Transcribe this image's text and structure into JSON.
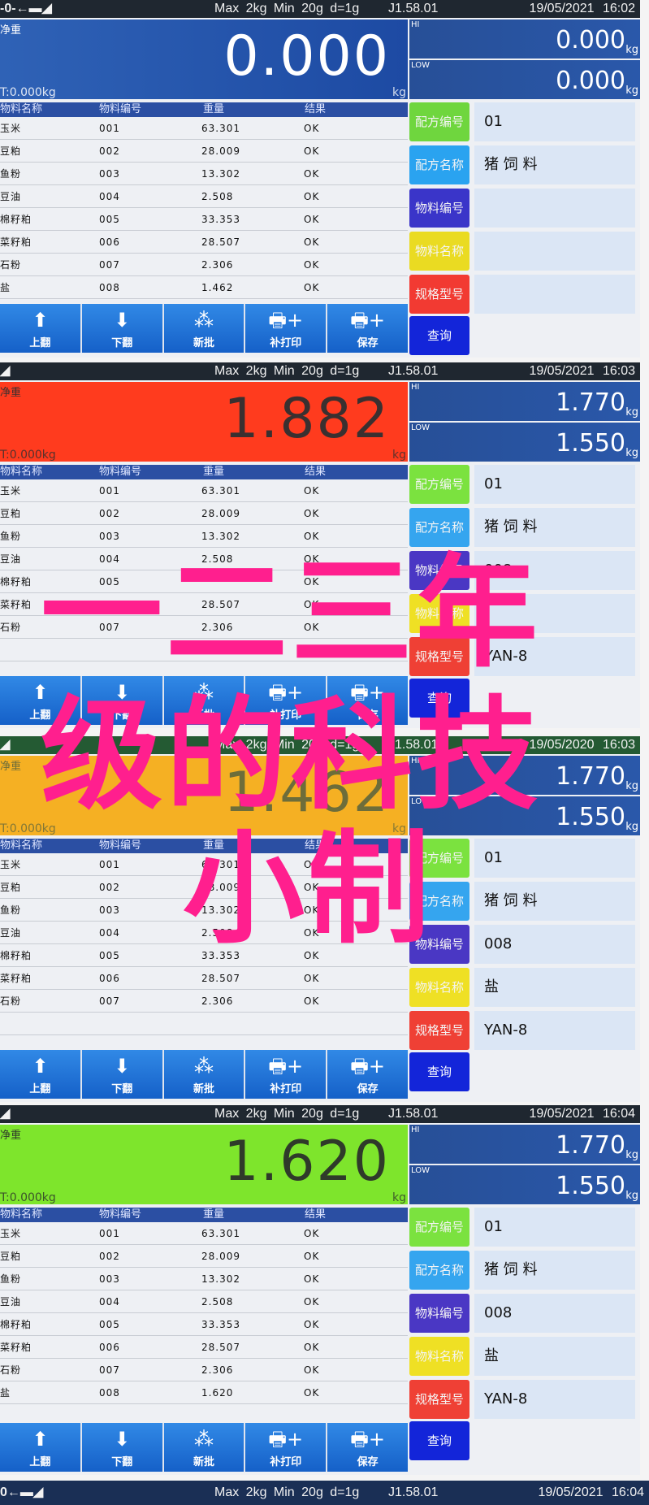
{
  "screens": [
    {
      "status": {
        "zero_icon": "-0-←▬◢",
        "spec": "Max 2kg  Min 20g  d=1g",
        "version": "J1.58.01",
        "datetime": "19/05/2021  16:02"
      },
      "net": {
        "label": "净重",
        "value": "0.000",
        "tare": "T:0.000kg",
        "unit": "kg",
        "state_color": "#2458ad"
      },
      "hi": {
        "tag": "HI",
        "value": "0.000",
        "unit": "kg"
      },
      "low": {
        "tag": "LOW",
        "value": "0.000",
        "unit": "kg"
      },
      "table": {
        "headers": [
          "物料名称",
          "物料编号",
          "重量",
          "结果"
        ],
        "rows": [
          [
            "玉米",
            "001",
            "63.301",
            "OK"
          ],
          [
            "豆粕",
            "002",
            "28.009",
            "OK"
          ],
          [
            "鱼粉",
            "003",
            "13.302",
            "OK"
          ],
          [
            "豆油",
            "004",
            "2.508",
            "OK"
          ],
          [
            "棉籽粕",
            "005",
            "33.353",
            "OK"
          ],
          [
            "菜籽粕",
            "006",
            "28.507",
            "OK"
          ],
          [
            "石粉",
            "007",
            "2.306",
            "OK"
          ],
          [
            "盐",
            "008",
            "1.462",
            "OK"
          ]
        ]
      },
      "side": [
        {
          "label": "配方编号",
          "value": "01",
          "color": "#6fd63e"
        },
        {
          "label": "配方名称",
          "value": "猪 饲 料",
          "color": "#2aa3f0"
        },
        {
          "label": "物料编号",
          "value": "",
          "color": "#3a35c9"
        },
        {
          "label": "物料名称",
          "value": "",
          "color": "#eadb22"
        },
        {
          "label": "规格型号",
          "value": "",
          "color": "#f23a32"
        }
      ]
    },
    {
      "status": {
        "zero_icon": "◢",
        "spec": "Max 2kg  Min 20g  d=1g",
        "version": "J1.58.01",
        "datetime": "19/05/2021  16:03"
      },
      "net": {
        "label": "净重",
        "value": "1.882",
        "tare": "T:0.000kg",
        "unit": "kg",
        "state_color": "#ff3b1e"
      },
      "hi": {
        "tag": "HI",
        "value": "1.770",
        "unit": "kg"
      },
      "low": {
        "tag": "LOW",
        "value": "1.550",
        "unit": "kg"
      },
      "table": {
        "headers": [
          "物料名称",
          "物料编号",
          "重量",
          "结果"
        ],
        "rows": [
          [
            "玉米",
            "001",
            "63.301",
            "OK"
          ],
          [
            "豆粕",
            "002",
            "28.009",
            "OK"
          ],
          [
            "鱼粉",
            "003",
            "13.302",
            "OK"
          ],
          [
            "豆油",
            "004",
            "2.508",
            "OK"
          ],
          [
            "棉籽粕",
            "005",
            "",
            "OK"
          ],
          [
            "菜籽粕",
            "006",
            "28.507",
            "OK"
          ],
          [
            "石粉",
            "007",
            "2.306",
            "OK"
          ],
          [
            "",
            "",
            "",
            ""
          ]
        ]
      },
      "side": [
        {
          "label": "配方编号",
          "value": "01",
          "color": "#7be23f"
        },
        {
          "label": "配方名称",
          "value": "猪 饲 料",
          "color": "#35a5ef"
        },
        {
          "label": "物料编号",
          "value": "008",
          "color": "#4a37c4"
        },
        {
          "label": "物料名称",
          "value": "",
          "color": "#efe024"
        },
        {
          "label": "规格型号",
          "value": "YAN-8",
          "color": "#ef4035"
        }
      ]
    },
    {
      "status": {
        "zero_icon": "◢",
        "spec": "Max 2kg  Min 20g  d=1g",
        "version": "J1.58.01",
        "datetime": "19/05/2020  16:03"
      },
      "net": {
        "label": "净重",
        "value": "1.462",
        "tare": "T:0.000kg",
        "unit": "kg",
        "state_color": "#f5b023"
      },
      "hi": {
        "tag": "HI",
        "value": "1.770",
        "unit": "kg"
      },
      "low": {
        "tag": "LOW",
        "value": "1.550",
        "unit": "kg"
      },
      "table": {
        "headers": [
          "物料名称",
          "物料编号",
          "重量",
          "结果"
        ],
        "rows": [
          [
            "玉米",
            "001",
            "63.301",
            "OK"
          ],
          [
            "豆粕",
            "002",
            "28.009",
            "OK"
          ],
          [
            "鱼粉",
            "003",
            "13.302",
            "OK"
          ],
          [
            "豆油",
            "004",
            "2.508",
            "OK"
          ],
          [
            "棉籽粕",
            "005",
            "33.353",
            "OK"
          ],
          [
            "菜籽粕",
            "006",
            "28.507",
            "OK"
          ],
          [
            "石粉",
            "007",
            "2.306",
            "OK"
          ],
          [
            "",
            "",
            "",
            ""
          ]
        ]
      },
      "side": [
        {
          "label": "配方编号",
          "value": "01",
          "color": "#7be23f"
        },
        {
          "label": "配方名称",
          "value": "猪 饲 料",
          "color": "#35a5ef"
        },
        {
          "label": "物料编号",
          "value": "008",
          "color": "#4a37c4"
        },
        {
          "label": "物料名称",
          "value": "盐",
          "color": "#efe024"
        },
        {
          "label": "规格型号",
          "value": "YAN-8",
          "color": "#ef4035"
        }
      ]
    },
    {
      "status": {
        "zero_icon": "◢",
        "spec": "Max 2kg  Min 20g  d=1g",
        "version": "J1.58.01",
        "datetime": "19/05/2021  16:04"
      },
      "net": {
        "label": "净重",
        "value": "1.620",
        "tare": "T:0.000kg",
        "unit": "kg",
        "state_color": "#7ee52c"
      },
      "hi": {
        "tag": "HI",
        "value": "1.770",
        "unit": "kg"
      },
      "low": {
        "tag": "LOW",
        "value": "1.550",
        "unit": "kg"
      },
      "table": {
        "headers": [
          "物料名称",
          "物料编号",
          "重量",
          "结果"
        ],
        "rows": [
          [
            "玉米",
            "001",
            "63.301",
            "OK"
          ],
          [
            "豆粕",
            "002",
            "28.009",
            "OK"
          ],
          [
            "鱼粉",
            "003",
            "13.302",
            "OK"
          ],
          [
            "豆油",
            "004",
            "2.508",
            "OK"
          ],
          [
            "棉籽粕",
            "005",
            "33.353",
            "OK"
          ],
          [
            "菜籽粕",
            "006",
            "28.507",
            "OK"
          ],
          [
            "石粉",
            "007",
            "2.306",
            "OK"
          ],
          [
            "盐",
            "008",
            "1.620",
            "OK"
          ]
        ]
      },
      "side": [
        {
          "label": "配方编号",
          "value": "01",
          "color": "#7be23f"
        },
        {
          "label": "配方名称",
          "value": "猪 饲 料",
          "color": "#35a5ef"
        },
        {
          "label": "物料编号",
          "value": "008",
          "color": "#4a37c4"
        },
        {
          "label": "物料名称",
          "value": "盐",
          "color": "#efe024"
        },
        {
          "label": "规格型号",
          "value": "YAN-8",
          "color": "#ef4035"
        }
      ]
    }
  ],
  "toolbar": [
    {
      "label": "上翻",
      "icon": "arrow-up-icon",
      "glyph": "⬆"
    },
    {
      "label": "下翻",
      "icon": "arrow-down-icon",
      "glyph": "⬇"
    },
    {
      "label": "新批",
      "icon": "batch-stack-icon",
      "glyph": "⁂"
    },
    {
      "label": "补打印",
      "icon": "printer-plus-icon",
      "glyph": "🖶+"
    },
    {
      "label": "保存",
      "icon": "save-printer-icon",
      "glyph": "🖶+"
    }
  ],
  "query_label": "查询",
  "bottom_status": {
    "zero_icon": "0←▬◢",
    "spec": "Max 2kg  Min 20g  d=1g",
    "version": "J1.58.01",
    "datetime": "19/05/2021  16:04"
  },
  "overlay_text": [
    "一二三年",
    "级的科技",
    "小制"
  ],
  "overlay_color": "#ff1f8e"
}
